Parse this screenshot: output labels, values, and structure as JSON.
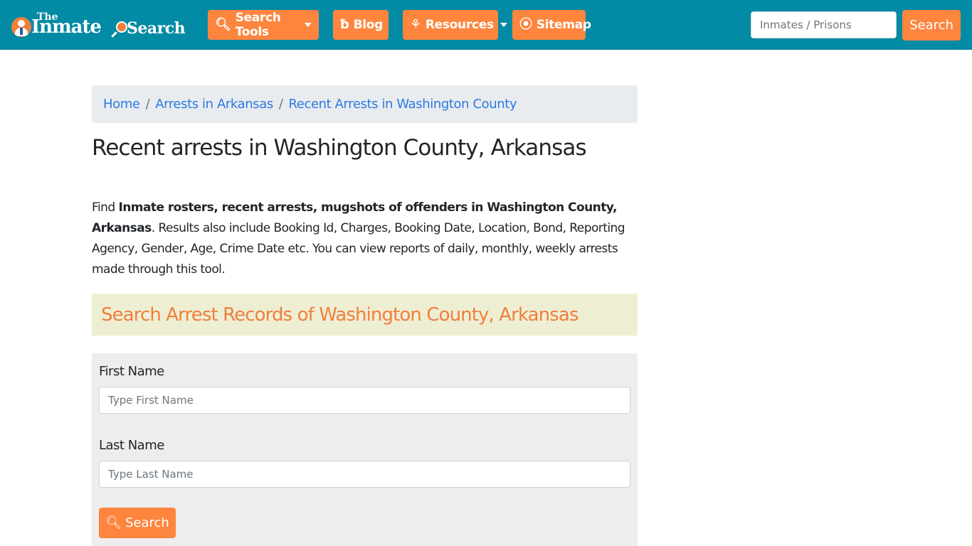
{
  "brand": {
    "logo_the": "The",
    "logo_inmate": "Inmate",
    "logo_search": "Search"
  },
  "nav": {
    "items": [
      {
        "label": "Search Tools",
        "icon": "search-icon",
        "dropdown": true
      },
      {
        "label": "Blog",
        "icon": "blog-icon",
        "dropdown": false
      },
      {
        "label": "Resources",
        "icon": "leaf-icon",
        "dropdown": true
      },
      {
        "label": "Sitemap",
        "icon": "rss-icon",
        "dropdown": false
      }
    ],
    "search_placeholder": "Inmates / Prisons",
    "search_button": "Search"
  },
  "breadcrumb": {
    "items": [
      "Home",
      "Arrests in Arkansas",
      "Recent Arrests in Washington County"
    ],
    "separator": "/"
  },
  "page": {
    "title": "Recent arrests in Washington County, Arkansas",
    "intro_prefix": "Find ",
    "intro_bold": "Inmate rosters, recent arrests, mugshots of offenders in Washington County, Arkansas",
    "intro_suffix": ". Results also include Booking Id, Charges, Booking Date, Location, Bond, Reporting Agency, Gender, Age, Crime Date etc. You can view reports of daily, monthly, weekly arrests made through this tool."
  },
  "search_form": {
    "heading": "Search Arrest Records of Washington County, Arkansas",
    "first_name_label": "First Name",
    "first_name_placeholder": "Type First Name",
    "first_name_value": "",
    "last_name_label": "Last Name",
    "last_name_placeholder": "Type Last Name",
    "last_name_value": "",
    "submit_label": "Search"
  },
  "colors": {
    "navbar": "#038aa4",
    "accent": "#fd853e",
    "link": "#2a7ae2",
    "section_bg": "#eeeed3",
    "panel_bg": "#ededed"
  }
}
